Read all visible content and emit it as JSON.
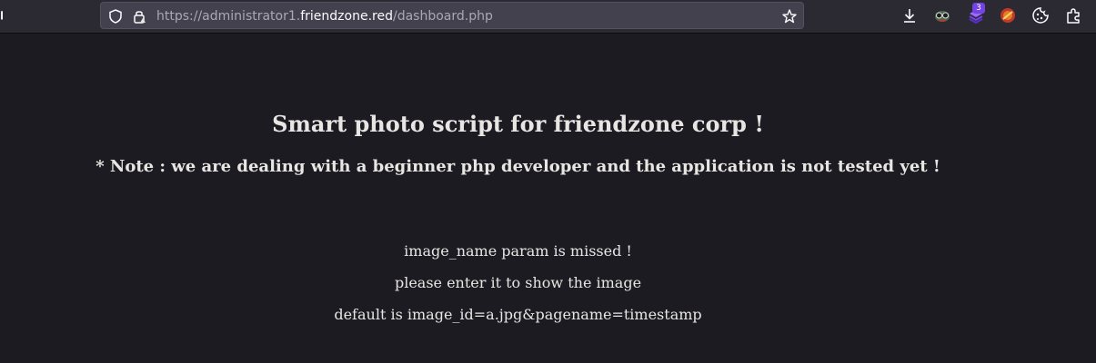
{
  "browser": {
    "url": {
      "prefix": "https://administrator1.",
      "host": "friendzone.red",
      "path": "/dashboard.php"
    },
    "extension_badge": "3",
    "icons": [
      "shield-icon",
      "lock-icon",
      "bookmark-star-icon",
      "download-icon",
      "extension-icon",
      "cookie-icon",
      "extensions-puzzle-icon"
    ]
  },
  "page": {
    "heading": "Smart photo script for friendzone corp !",
    "note": "* Note : we are dealing with a beginner php developer and the application is not tested yet !",
    "messages": [
      "image_name param is missed !",
      "please enter it to show the image",
      "default is image_id=a.jpg&pagename=timestamp"
    ]
  },
  "colors": {
    "page_background": "#1c1b22",
    "toolbar_background": "#2b2a33",
    "urlbar_background": "#42414d",
    "text": "#e8e6e3",
    "badge": "#7542e5"
  }
}
